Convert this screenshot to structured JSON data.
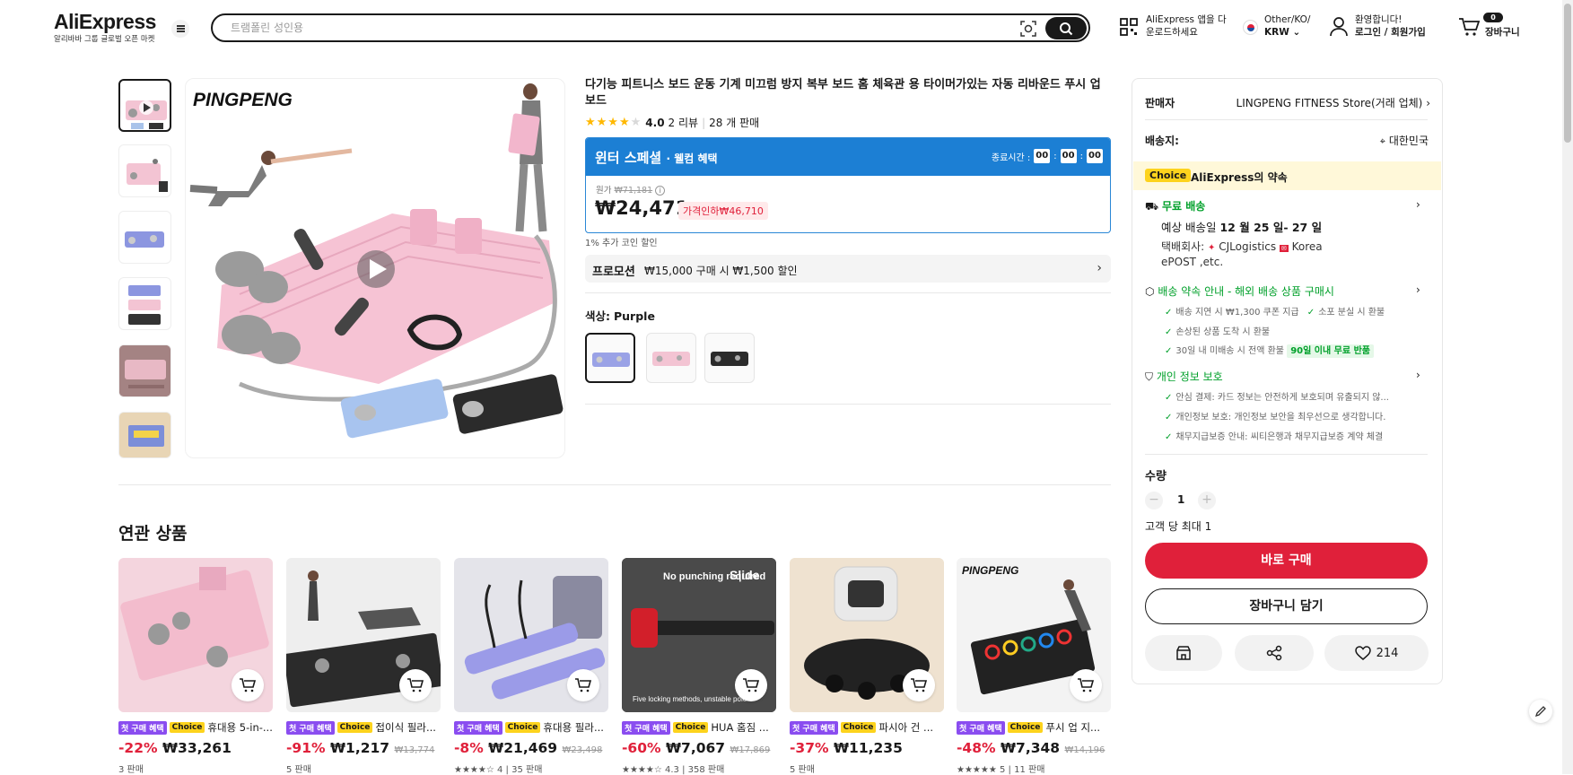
{
  "header": {
    "logo_main": "AliExpress",
    "logo_sub": "알리바바 그룹 글로벌 오픈 마켓",
    "search_placeholder": "트램폴린 성인용",
    "app_line1": "AliExpress 앱을 다",
    "app_line2": "운로드하세요",
    "locale_line1": "Other/KO/",
    "locale_line2": "KRW",
    "account_line1": "환영합니다!",
    "account_line2": "로그인 / 회원가입",
    "cart_count": "0",
    "cart_label": "장바구니"
  },
  "gallery": {
    "brand": "PINGPENG",
    "selected_index": 0
  },
  "product": {
    "title": "다기능 피트니스 보드 운동 기계 미끄럼 방지 복부 보드 홈 체육관 용 타이머가있는 자동 리바운드 푸시 업 보드",
    "rating_value": "4.0",
    "stars": 4,
    "reviews": "2 리뷰",
    "sold": "28 개 판매",
    "banner_title": "윈터 스페셜",
    "banner_sub": "· 웰컴 혜택",
    "ends_label": "종료시간 :",
    "timer": [
      "00",
      "00",
      "00"
    ],
    "original_label": "원가",
    "original_price": "₩71,181",
    "price": "₩24,471",
    "discount_label": "가격인하₩46,710",
    "coin_note": "1% 추가 코인 할인",
    "promo_label": "프로모션",
    "promo_text": "₩15,000 구매 시 ₩1,500 할인",
    "color_label": "색상:",
    "color_value": "Purple"
  },
  "seller": {
    "label": "판매자",
    "value": "LINGPENG FITNESS Store(거래 업체)",
    "ship_to_label": "배송지:",
    "ship_to_value": "대한민국",
    "choice_tag": "Choice",
    "choice_text": "AliExpress의 약속",
    "free_ship": "무료 배송",
    "eta_prefix": "예상 배송일",
    "eta_value": "12 월 25 일- 27 일",
    "courier_label": "택배회사:",
    "courier_1": "CJLogistics",
    "courier_2": "Korea",
    "courier_3": "ePOST ,etc.",
    "promise_title": "배송 약속 안내 - 해외 배송 상품 구매시",
    "promise_1": "배송 지연 시 ₩1,300 쿠폰 지급",
    "promise_2": "소포 분실 시 환불",
    "promise_3": "손상된 상품 도착 시 환불",
    "promise_4": "30일 내 미배송 시 전액 환불",
    "promise_badge": "90일 이내 무료 반품",
    "privacy_title": "개인 정보 보호",
    "privacy_1": "안심 결제: 카드 정보는 안전하게 보호되며 유출되지 않...",
    "privacy_2": "개인정보 보호: 개인정보 보안을 최우선으로 생각합니다.",
    "privacy_3": "채무지급보증 안내: 씨티은행과 채무지급보증 계약 체결",
    "qty_label": "수량",
    "qty_value": "1",
    "max_note": "고객 당 최대 1",
    "buy_now": "바로 구매",
    "add_to_cart": "장바구니 담기",
    "wish_count": "214"
  },
  "related": {
    "title": "연관 상품",
    "first_tag": "첫 구매 혜택",
    "choice_tag": "Choice",
    "items": [
      {
        "name": "휴대용 5-in-...",
        "pct": "-22%",
        "price": "₩33,261",
        "orig": "",
        "sub": "3 판매",
        "stars": ""
      },
      {
        "name": "접이식 필라...",
        "pct": "-91%",
        "price": "₩1,217",
        "orig": "₩13,774",
        "sub": "5 판매",
        "stars": ""
      },
      {
        "name": "휴대용 필라...",
        "pct": "-8%",
        "price": "₩21,469",
        "orig": "₩23,498",
        "sub": "4 | 35 판매",
        "stars": "★★★★☆"
      },
      {
        "name": "HUA 홈짐 ...",
        "pct": "-60%",
        "price": "₩7,067",
        "orig": "₩17,869",
        "sub": "4.3 | 358 판매",
        "stars": "★★★★☆"
      },
      {
        "name": "파시아 건 ...",
        "pct": "-37%",
        "price": "₩11,235",
        "orig": "",
        "sub": "5 판매",
        "stars": ""
      },
      {
        "name": "푸시 업 지...",
        "pct": "-48%",
        "price": "₩7,348",
        "orig": "₩14,196",
        "sub": "5 | 11 판매",
        "stars": "★★★★★"
      }
    ],
    "img4_text1": "No punching required",
    "img4_text2": "Slide",
    "img4_text3": "Five locking methods, unstable pole",
    "img6_brand": "PINGPENG"
  },
  "colors": {
    "accent_red": "#e0203a",
    "banner_blue": "#1c7fd4",
    "choice_yellow": "#fdd31d",
    "green": "#00a02a"
  }
}
